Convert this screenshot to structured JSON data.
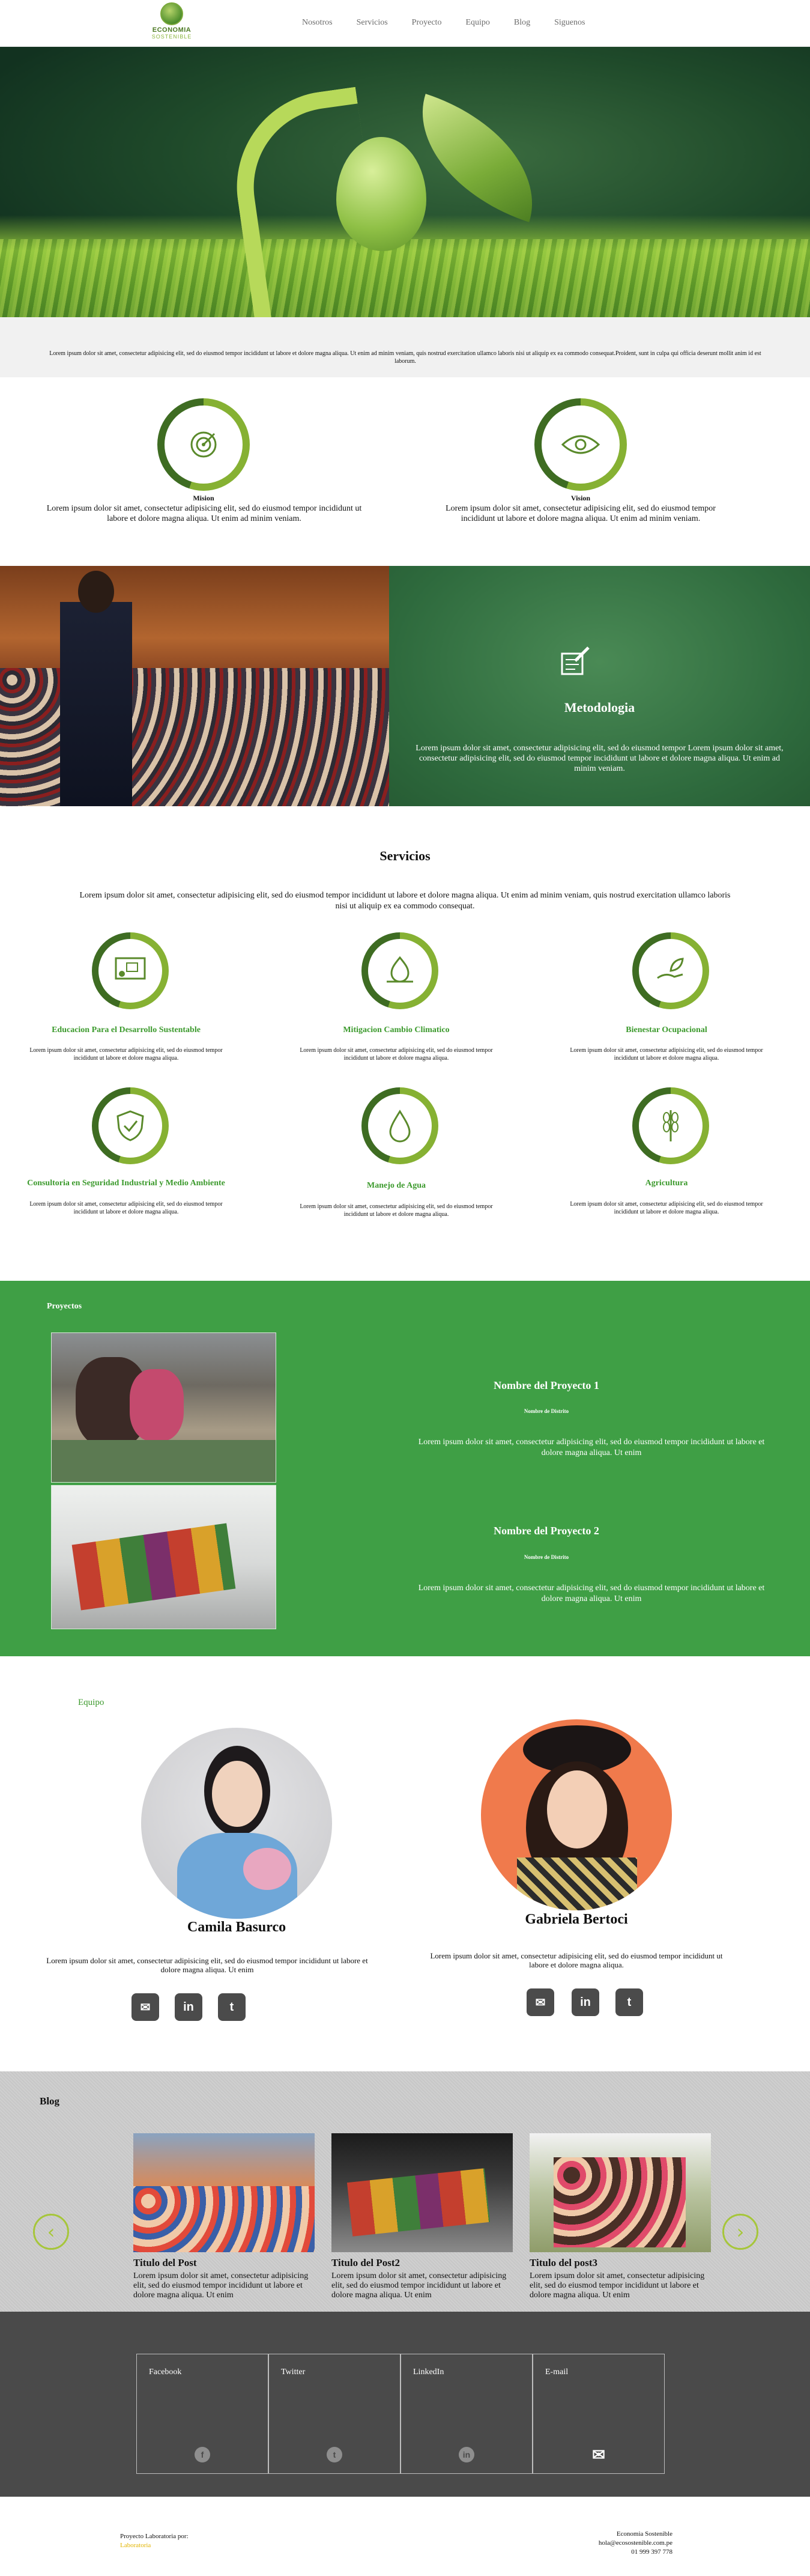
{
  "header": {
    "logo_title": "ECONOMIA",
    "logo_sub": "SOSTENIBLE",
    "nav": [
      "Nosotros",
      "Servicios",
      "Proyecto",
      "Equipo",
      "Blog",
      "Siguenos"
    ]
  },
  "intro": {
    "text": "Lorem ipsum dolor sit amet, consectetur adipisicing elit, sed do eiusmod tempor incididunt ut labore et dolore magna aliqua. Ut enim ad minim veniam, quis nostrud exercitation ullamco laboris nisi ut aliquip ex ea commodo consequat.Proident, sunt in culpa qui officia deserunt mollit anim id est laborum."
  },
  "mission": {
    "title": "Mision",
    "text": "Lorem ipsum dolor sit amet, consectetur adipisicing elit, sed do eiusmod tempor incididunt ut labore et dolore magna aliqua. Ut enim ad minim veniam."
  },
  "vision": {
    "title": "Vision",
    "text": "Lorem ipsum dolor sit amet, consectetur adipisicing elit, sed do eiusmod tempor incididunt ut labore et dolore magna aliqua. Ut enim ad minim veniam."
  },
  "metodologia": {
    "title": "Metodologia",
    "text": "Lorem ipsum dolor sit amet, consectetur adipisicing elit, sed do eiusmod tempor Lorem ipsum dolor sit amet, consectetur adipisicing elit, sed do eiusmod tempor incididunt ut labore et dolore magna aliqua. Ut enim ad minim veniam."
  },
  "servicios": {
    "title": "Servicios",
    "intro": "Lorem ipsum dolor sit amet, consectetur adipisicing elit, sed do eiusmod tempor incididunt ut labore et dolore magna aliqua. Ut enim ad minim veniam, quis nostrud exercitation ullamco laboris nisi ut aliquip ex ea commodo consequat.",
    "items": [
      {
        "title": "Educacion Para el Desarrollo Sustentable",
        "text": "Lorem ipsum dolor sit amet, consectetur adipisicing elit, sed do eiusmod tempor incididunt ut labore et dolore magna aliqua.",
        "icon": "presentation-icon"
      },
      {
        "title": "Mitigacion Cambio Climatico",
        "text": "Lorem ipsum dolor sit amet, consectetur adipisicing elit, sed do eiusmod tempor incididunt ut labore et dolore magna aliqua.",
        "icon": "recycle-icon"
      },
      {
        "title": "Bienestar Ocupacional",
        "text": "Lorem ipsum dolor sit amet, consectetur adipisicing elit, sed do eiusmod tempor incididunt ut labore et dolore magna aliqua.",
        "icon": "hand-leaf-icon"
      },
      {
        "title": "Consultoria en Seguridad Industrial y Medio Ambiente",
        "text": "Lorem ipsum dolor sit amet, consectetur adipisicing elit, sed do eiusmod tempor incididunt ut labore et dolore magna aliqua.",
        "icon": "shield-check-icon"
      },
      {
        "title": "Manejo de Agua",
        "text": "Lorem ipsum dolor sit amet, consectetur adipisicing elit, sed do eiusmod tempor incididunt ut labore et dolore magna aliqua.",
        "icon": "water-drop-icon"
      },
      {
        "title": "Agricultura",
        "text": "Lorem ipsum dolor sit amet, consectetur adipisicing elit, sed do eiusmod tempor incididunt ut labore et dolore magna aliqua.",
        "icon": "wheat-icon"
      }
    ]
  },
  "proyectos": {
    "title": "Proyectos",
    "items": [
      {
        "name": "Nombre del Proyecto 1",
        "district": "Nombre de Distrito",
        "text": "Lorem ipsum dolor sit amet, consectetur adipisicing elit, sed do eiusmod tempor incididunt ut labore et dolore magna aliqua. Ut enim"
      },
      {
        "name": "Nombre del Proyecto 2",
        "district": "Nombre de Distrito",
        "text": "Lorem ipsum dolor sit amet, consectetur adipisicing elit, sed do eiusmod tempor incididunt ut labore et dolore magna aliqua. Ut enim"
      }
    ]
  },
  "equipo": {
    "title": "Equipo",
    "members": [
      {
        "name": "Camila Basurco",
        "text": "Lorem ipsum dolor sit amet, consectetur adipisicing elit, sed do eiusmod tempor incididunt ut labore et dolore magna aliqua. Ut enim"
      },
      {
        "name": "Gabriela Bertoci",
        "text": "Lorem ipsum dolor sit amet, consectetur adipisicing elit, sed do eiusmod tempor incididunt ut labore et dolore magna aliqua."
      }
    ],
    "social_icons": [
      "mail-icon",
      "linkedin-icon",
      "twitter-icon"
    ]
  },
  "blog": {
    "title": "Blog",
    "posts": [
      {
        "title": "Titulo del Post",
        "text": "Lorem ipsum dolor sit amet, consectetur adipisicing elit, sed do eiusmod tempor incididunt ut labore et dolore magna aliqua. Ut enim"
      },
      {
        "title": "Titulo del Post2",
        "text": "Lorem ipsum dolor sit amet, consectetur adipisicing elit, sed do eiusmod tempor incididunt ut labore et dolore magna aliqua. Ut enim"
      },
      {
        "title": "Titulo del post3",
        "text": "Lorem ipsum dolor sit amet, consectetur adipisicing elit, sed do eiusmod tempor incididunt ut labore et dolore magna aliqua. Ut enim"
      }
    ],
    "prev_symbol": "‹",
    "next_symbol": "›"
  },
  "social": {
    "items": [
      {
        "label": "Facebook",
        "glyph": "f"
      },
      {
        "label": "Twitter",
        "glyph": "t"
      },
      {
        "label": "LinkedIn",
        "glyph": "in"
      },
      {
        "label": "E-mail",
        "glyph": "✉"
      }
    ]
  },
  "footer": {
    "left_line1": "Proyecto Laboratoria por:",
    "left_line2": "Laboratoria",
    "right_line1": "Economia Sostenible",
    "right_line2": "hola@ecosostenible.com.pe",
    "right_line3": "01 999 397 778"
  },
  "colors": {
    "accent_green": "#3f9f45",
    "ring_light": "#86b133",
    "ring_dark": "#3e6c22",
    "service_title": "#3c9a2d",
    "dark_band": "#4a4a4a"
  }
}
